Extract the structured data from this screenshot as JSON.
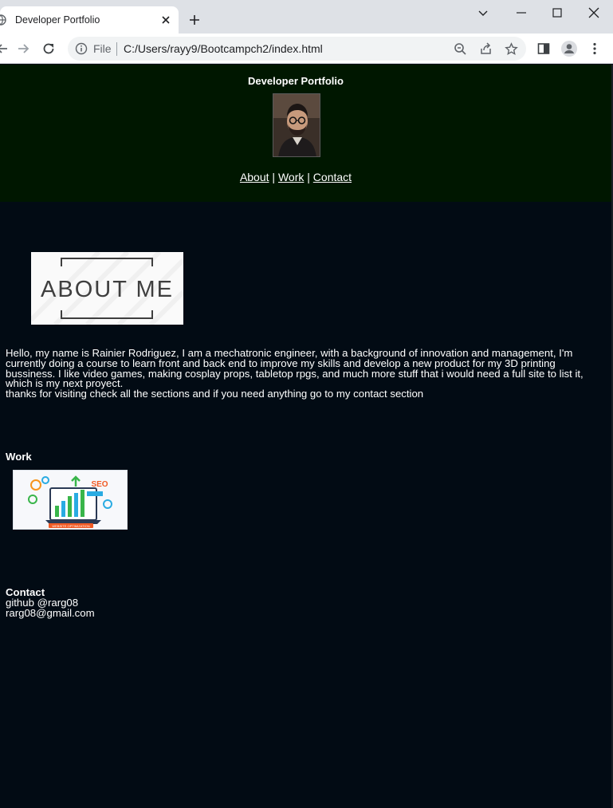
{
  "browser": {
    "tab_title": "Developer Portfolio",
    "scheme_label": "File",
    "url": "C:/Users/rayy9/Bootcampch2/index.html"
  },
  "header": {
    "title": "Developer Portfolio",
    "nav": [
      {
        "label": "About"
      },
      {
        "label": "Work"
      },
      {
        "label": "Contact"
      }
    ],
    "nav_separator": "|"
  },
  "about": {
    "image_text": "ABOUT ME",
    "paragraph": "Hello, my name is Rainier Rodriguez, I am a mechatronic engineer, with a background of innovation and management, I'm currently doing a course to learn front and back end to improve my skills and develop a new product for my 3D printing bussiness. I like video games, making cosplay props, tabletop rpgs, and much more stuff that i would need a full site to list it, which is my next proyect.",
    "closing": "thanks for visiting check all the sections and if you need anything go to my contact section"
  },
  "work": {
    "heading": "Work",
    "image_banner": "WEBSITE OPTIMIZATION",
    "image_badge": "SEO"
  },
  "contact": {
    "heading": "Contact",
    "github": "github @rarg08",
    "email": "rarg08@gmail.com"
  },
  "colors": {
    "header_bg": "#001700",
    "page_bg": "#020b14",
    "text": "#ffffff"
  },
  "icons": [
    "globe-icon",
    "close-icon",
    "plus-icon",
    "minimize-icon",
    "maximize-icon",
    "back-icon",
    "forward-icon",
    "reload-icon",
    "info-icon",
    "zoom-icon",
    "share-icon",
    "star-icon",
    "sidepanel-icon",
    "profile-icon",
    "menu-icon"
  ]
}
